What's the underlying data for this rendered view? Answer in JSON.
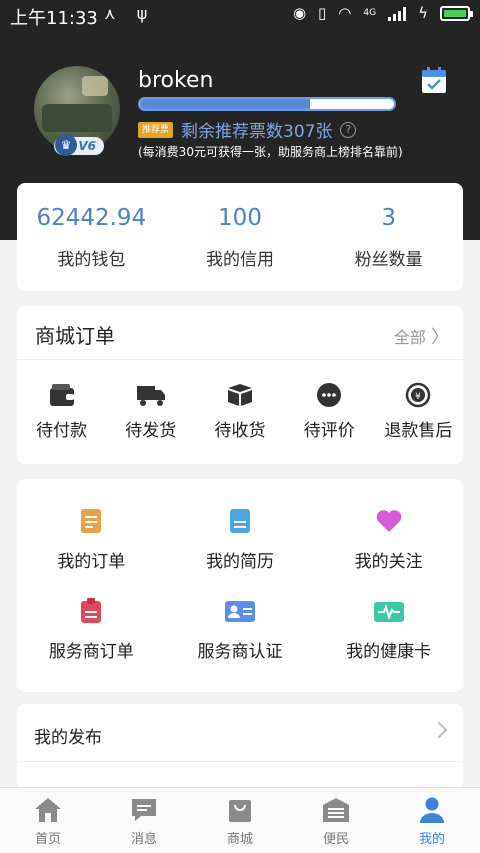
{
  "status_bar": {
    "time": "上午11:33",
    "network": "4G"
  },
  "profile": {
    "username": "broken",
    "level": "V6",
    "progress_fraction": 0.67,
    "vote_tag": "推荐票",
    "votes_text": "剩余推荐票数307张",
    "help": "?",
    "note": "(每消费30元可获得一张，助服务商上榜排名靠前)"
  },
  "stats": [
    {
      "value": "62442.94",
      "label": "我的钱包"
    },
    {
      "value": "100",
      "label": "我的信用"
    },
    {
      "value": "3",
      "label": "粉丝数量"
    }
  ],
  "orders": {
    "title": "商城订单",
    "all_label": "全部",
    "items": [
      {
        "label": "待付款",
        "icon": "wallet-icon"
      },
      {
        "label": "待发货",
        "icon": "truck-icon"
      },
      {
        "label": "待收货",
        "icon": "box-icon"
      },
      {
        "label": "待评价",
        "icon": "comment-icon"
      },
      {
        "label": "退款售后",
        "icon": "refund-icon"
      }
    ]
  },
  "features": [
    {
      "label": "我的订单",
      "icon": "order-list-icon",
      "color": "#e8a24a"
    },
    {
      "label": "我的简历",
      "icon": "resume-icon",
      "color": "#4aa6e0"
    },
    {
      "label": "我的关注",
      "icon": "heart-icon",
      "color": "#d85ad8"
    },
    {
      "label": "服务商订单",
      "icon": "provider-order-icon",
      "color": "#e04a5e"
    },
    {
      "label": "服务商认证",
      "icon": "id-card-icon",
      "color": "#5b8fe6"
    },
    {
      "label": "我的健康卡",
      "icon": "health-card-icon",
      "color": "#3cc8a8"
    }
  ],
  "publish": {
    "label": "我的发布"
  },
  "tabs": [
    {
      "label": "首页",
      "icon": "home-icon"
    },
    {
      "label": "消息",
      "icon": "message-icon"
    },
    {
      "label": "商城",
      "icon": "shop-bag-icon"
    },
    {
      "label": "便民",
      "icon": "building-icon"
    },
    {
      "label": "我的",
      "icon": "user-icon",
      "active": true
    }
  ],
  "colors": {
    "accent": "#4e7fc9",
    "header_bg": "#242424",
    "active_tab": "#3f82d6"
  }
}
